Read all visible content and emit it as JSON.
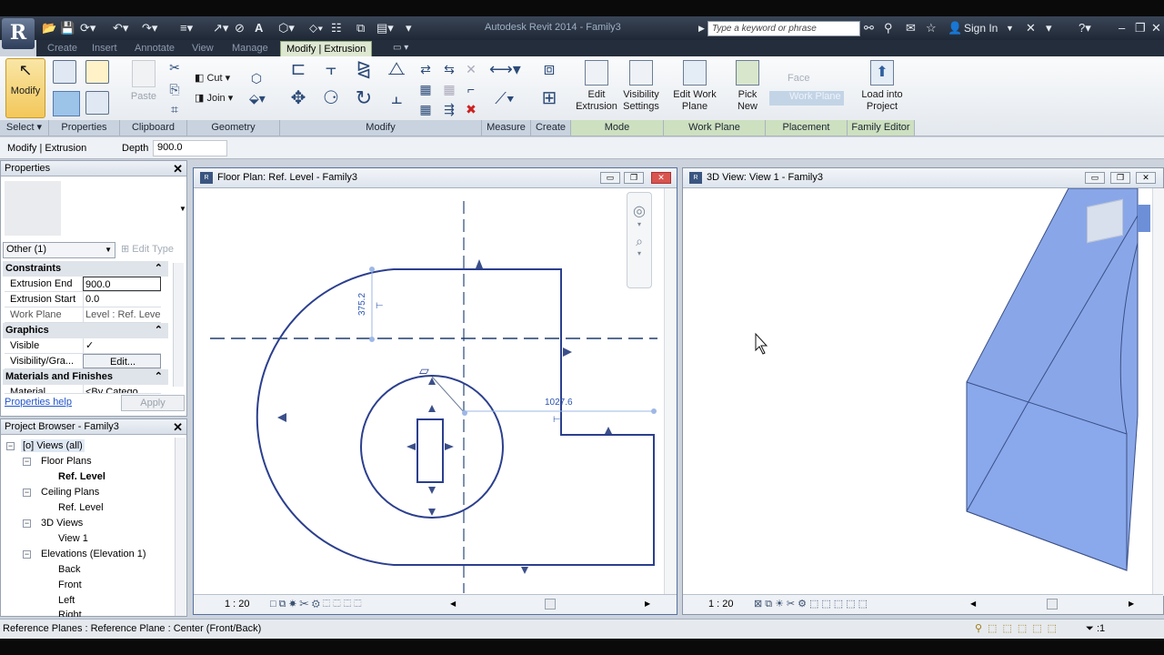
{
  "window": {
    "title": "Autodesk Revit 2014 -    Family3",
    "search_placeholder": "Type a keyword or phrase",
    "sign_in": "Sign In"
  },
  "tabs": [
    "Create",
    "Insert",
    "Annotate",
    "View",
    "Manage",
    "Modify | Extrusion"
  ],
  "ribbon": {
    "modify_label": "Modify",
    "panels": [
      "Select",
      "Properties",
      "Clipboard",
      "Geometry",
      "Modify",
      "Measure",
      "Create",
      "Mode",
      "Work Plane",
      "Placement",
      "Family Editor"
    ],
    "clipboard": {
      "paste": "Paste"
    },
    "geometry": {
      "cut": "Cut",
      "join": "Join"
    },
    "mode": {
      "edit_extrusion": "Edit Extrusion",
      "visibility_settings": "Visibility Settings"
    },
    "work_plane": {
      "edit_work_plane": "Edit Work Plane",
      "pick_new": "Pick New"
    },
    "placement": {
      "face": "Face",
      "work_plane": "Work Plane"
    },
    "family_editor": {
      "load_into_project": "Load into Project"
    }
  },
  "options_bar": {
    "context": "Modify | Extrusion",
    "depth_label": "Depth",
    "depth_value": "900.0"
  },
  "properties": {
    "title": "Properties",
    "type_selector": "Other (1)",
    "edit_type": "Edit Type",
    "groups": {
      "constraints": "Constraints",
      "graphics": "Graphics",
      "materials": "Materials and Finishes"
    },
    "rows": [
      {
        "key": "Extrusion End",
        "value": "900.0"
      },
      {
        "key": "Extrusion Start",
        "value": "0.0"
      },
      {
        "key": "Work Plane",
        "value": "Level : Ref. Level"
      },
      {
        "key": "Visible",
        "value": "✓"
      },
      {
        "key": "Visibility/Gra...",
        "value": "Edit..."
      },
      {
        "key": "Material",
        "value": "<By Catego"
      }
    ],
    "help": "Properties help",
    "apply": "Apply"
  },
  "browser": {
    "title": "Project Browser - Family3",
    "items": [
      "Views (all)",
      "Floor Plans",
      "Ref. Level",
      "Ceiling Plans",
      "Ref. Level",
      "3D Views",
      "View 1",
      "Elevations (Elevation 1)",
      "Back",
      "Front",
      "Left",
      "Right"
    ]
  },
  "views": {
    "plan": {
      "title": "Floor Plan: Ref. Level - Family3",
      "scale": "1 : 20",
      "dim1": "375.2",
      "dim2": "1027.6"
    },
    "view3d": {
      "title": "3D View: View 1 - Family3",
      "scale": "1 : 20"
    }
  },
  "status": {
    "text": "Reference Planes : Reference Plane : Center (Front/Back)",
    "filter_count": ":1"
  },
  "colors": {
    "accent": "#2a3d8f",
    "extrusion": "#7f9fe6",
    "ribbon_context": "#cde0c0"
  }
}
